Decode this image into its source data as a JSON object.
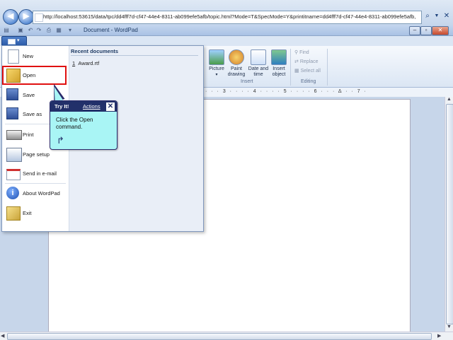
{
  "browser": {
    "address_host": "localhost",
    "address_url": "http://localhost:53615/data/tpc/dd4fff7d-cf47-44e4-8311-ab099efe5afb/topic.html?Mode=T&SpecMode=Y&printitname=dd4fff7d-cf47-44e4-8311-ab099efe5afb,"
  },
  "wordpad": {
    "title": "Document - WordPad"
  },
  "ribbon": {
    "picture": "Picture",
    "paint_drawing": "Paint drawing",
    "date_and_time": "Date and time",
    "insert_object": "Insert object",
    "insert_group": "Insert",
    "find": "Find",
    "replace": "Replace",
    "select_all": "Select all",
    "editing_group": "Editing"
  },
  "ruler": {
    "marks": "· · · 3 · · · · 4 · · · · 5 · · · · 6 · · · Δ · · 7 ·"
  },
  "app_menu": {
    "items": [
      {
        "label": "New",
        "icon": "new-document-icon"
      },
      {
        "label": "Open",
        "icon": "open-folder-icon"
      },
      {
        "label": "Save",
        "icon": "save-icon"
      },
      {
        "label": "Save as",
        "icon": "save-as-icon"
      },
      {
        "label": "Print",
        "icon": "printer-icon"
      },
      {
        "label": "Page setup",
        "icon": "page-setup-icon"
      },
      {
        "label": "Send in e-mail",
        "icon": "email-icon"
      },
      {
        "label": "About WordPad",
        "icon": "info-icon"
      },
      {
        "label": "Exit",
        "icon": "exit-icon"
      }
    ],
    "recent_title": "Recent documents",
    "recent": [
      {
        "num": "1",
        "name": "Award.rtf"
      }
    ]
  },
  "callout": {
    "try_it": "Try It!",
    "actions": "Actions",
    "close": "✕",
    "line1": "Click the Open",
    "line2": "command."
  },
  "colors": {
    "highlight": "#e01010",
    "callout_bg": "#a9f5f5",
    "callout_head": "#22306a"
  }
}
